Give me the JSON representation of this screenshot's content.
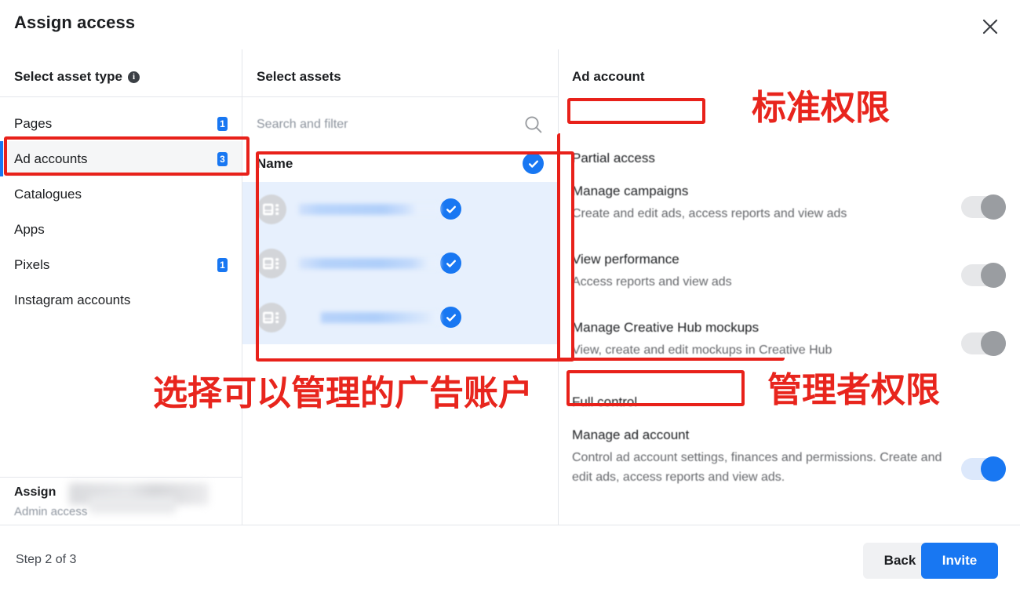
{
  "dialog": {
    "title": "Assign access",
    "close_icon": "close-icon",
    "step_label": "Step 2 of 3",
    "back_label": "Back",
    "invite_label": "Invite"
  },
  "colors": {
    "accent_blue": "#1877f2",
    "annotation_red": "#e8211a",
    "row_selected_bg": "#e7f0fd",
    "toggle_off_track": "#e6e7e9",
    "toggle_off_knob": "#9a9da1"
  },
  "left_panel": {
    "heading": "Select asset type",
    "info_icon": "info-icon",
    "info_glyph": "i",
    "items": [
      {
        "label": "Pages",
        "badge": "1",
        "selected": false
      },
      {
        "label": "Ad accounts",
        "badge": "3",
        "selected": true
      },
      {
        "label": "Catalogues",
        "badge": "",
        "selected": false
      },
      {
        "label": "Apps",
        "badge": "",
        "selected": false
      },
      {
        "label": "Pixels",
        "badge": "1",
        "selected": false
      },
      {
        "label": "Instagram accounts",
        "badge": "",
        "selected": false
      }
    ],
    "footer": {
      "assign_label": "Assign",
      "access_label": "Admin access"
    }
  },
  "middle_panel": {
    "heading": "Select assets",
    "search_placeholder": "Search and filter",
    "search_icon": "search-icon",
    "name_column_header": "Name",
    "header_checked": true,
    "rows": [
      {
        "name": "",
        "checked": true,
        "avatar_icon": "ad-account-icon"
      },
      {
        "name": "",
        "checked": true,
        "avatar_icon": "ad-account-icon"
      },
      {
        "name": "",
        "checked": true,
        "avatar_icon": "ad-account-icon"
      }
    ]
  },
  "right_panel": {
    "heading": "Ad account",
    "sections": [
      {
        "title": "Partial access",
        "permissions": [
          {
            "name": "Manage campaigns",
            "description": "Create and edit ads, access reports and view ads",
            "enabled": false
          },
          {
            "name": "View performance",
            "description": "Access reports and view ads",
            "enabled": false
          },
          {
            "name": "Manage Creative Hub mockups",
            "description": "View, create and edit mockups in Creative Hub",
            "enabled": false
          }
        ]
      },
      {
        "title": "Full control",
        "permissions": [
          {
            "name": "Manage ad account",
            "description": "Control ad account settings, finances and permissions. Create and edit ads, access reports and view ads.",
            "enabled": true
          }
        ]
      }
    ]
  },
  "annotations": {
    "standard_permission": "标准权限",
    "admin_permission": "管理者权限",
    "select_ad_accounts": "选择可以管理的广告账户"
  }
}
